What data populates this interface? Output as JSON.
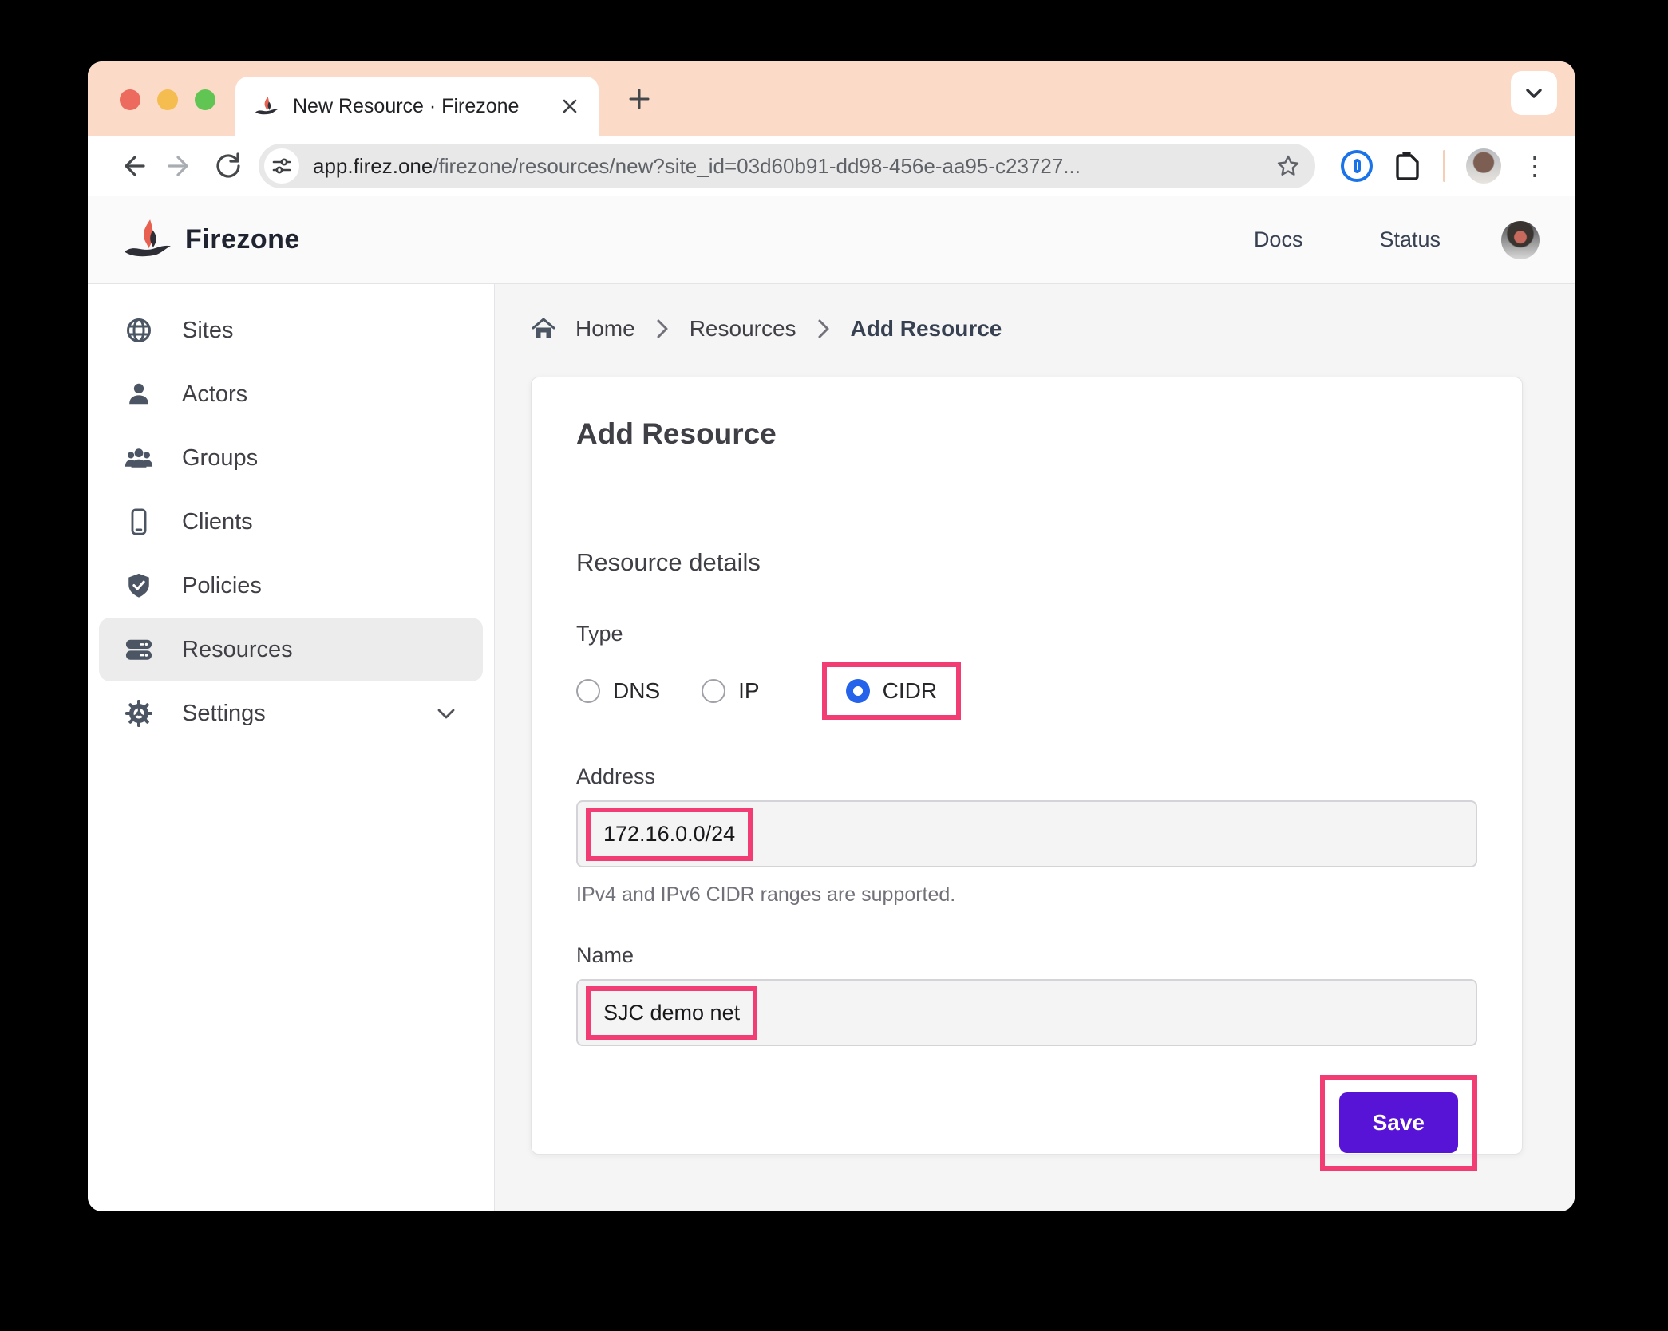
{
  "browser": {
    "tab_title": "New Resource · Firezone",
    "url_domain": "app.firez.one",
    "url_path": "/firezone/resources/new?site_id=03d60b91-dd98-456e-aa95-c23727..."
  },
  "app_header": {
    "brand": "Firezone",
    "docs_label": "Docs",
    "status_label": "Status"
  },
  "sidebar": {
    "items": [
      {
        "label": "Sites",
        "icon": "globe-icon"
      },
      {
        "label": "Actors",
        "icon": "user-icon"
      },
      {
        "label": "Groups",
        "icon": "users-icon"
      },
      {
        "label": "Clients",
        "icon": "mobile-icon"
      },
      {
        "label": "Policies",
        "icon": "shield-check-icon"
      },
      {
        "label": "Resources",
        "icon": "server-stack-icon",
        "active": true
      },
      {
        "label": "Settings",
        "icon": "gear-icon",
        "has_chevron": true
      }
    ]
  },
  "breadcrumb": {
    "items": [
      "Home",
      "Resources",
      "Add Resource"
    ]
  },
  "form": {
    "page_title": "Add Resource",
    "section_title": "Resource details",
    "type_label": "Type",
    "type_options": [
      {
        "label": "DNS",
        "selected": false
      },
      {
        "label": "IP",
        "selected": false
      },
      {
        "label": "CIDR",
        "selected": true
      }
    ],
    "address_label": "Address",
    "address_value": "172.16.0.0/24",
    "address_help": "IPv4 and IPv6 CIDR ranges are supported.",
    "name_label": "Name",
    "name_value": "SJC demo net",
    "save_label": "Save"
  },
  "icons": {
    "dots_vertical": "⋮"
  },
  "colors": {
    "annotation_pink": "#f23c74",
    "save_purple": "#5713d6",
    "radio_blue": "#2563eb",
    "tabstrip_peach": "#fbdbc8",
    "traffic_red": "#ec6a5e",
    "traffic_yellow": "#f5bd4f",
    "traffic_green": "#61c554"
  }
}
